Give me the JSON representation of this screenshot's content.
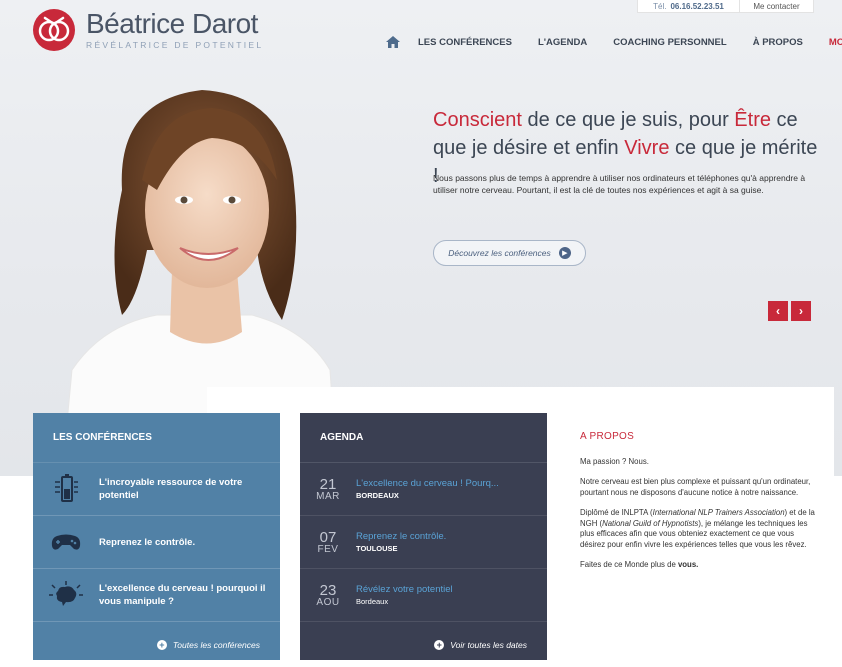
{
  "header": {
    "contact": {
      "tel_label": "Tél.",
      "tel_number": "06.16.52.23.51",
      "contact_label": "Me contacter"
    },
    "brand": {
      "name": "Béatrice Darot",
      "tagline": "RÉVÉLATRICE DE POTENTIEL"
    },
    "nav": {
      "home_icon": "home-icon",
      "items": [
        "LES CONFÉRENCES",
        "L'AGENDA",
        "COACHING PERSONNEL",
        "À PROPOS"
      ],
      "blog": "MON BLOG"
    }
  },
  "hero": {
    "headline": {
      "w1": "Conscient",
      "t1": " de ce que je suis, pour ",
      "w2": "Être",
      "t2": " ce que je désire et enfin ",
      "w3": "Vivre",
      "t3": " ce que je mérite !"
    },
    "lead": "Nous passons plus de temps à apprendre à utiliser nos ordinateurs et téléphones qu'à apprendre à utiliser notre cerveau. Pourtant, il est la clé de toutes nos expériences et agit à sa guise.",
    "cta": "Découvrez les conférences",
    "prev": "‹",
    "next": "›"
  },
  "conferences": {
    "title": "LES CONFÉRENCES",
    "items": [
      {
        "icon": "battery-icon",
        "label": "L'incroyable ressource de votre potentiel"
      },
      {
        "icon": "gamepad-icon",
        "label": "Reprenez le contrôle."
      },
      {
        "icon": "brain-icon",
        "label": "L'excellence du cerveau ! pourquoi il vous manipule ?"
      }
    ],
    "footer": "Toutes les conférences"
  },
  "agenda": {
    "title": "AGENDA",
    "items": [
      {
        "day": "21",
        "month": "MAR",
        "title": "L'excellence du cerveau ! Pourq...",
        "city": "BORDEAUX"
      },
      {
        "day": "07",
        "month": "FEV",
        "title": "Reprenez le contrôle.",
        "city": "TOULOUSE"
      },
      {
        "day": "23",
        "month": "AOU",
        "title": "Révélez votre potentiel",
        "city": "Bordeaux"
      }
    ],
    "footer": "Voir toutes les dates"
  },
  "about": {
    "title": "A PROPOS",
    "p1": "Ma passion ? Nous.",
    "p2": "Notre cerveau est bien plus complexe et puissant qu'un ordinateur, pourtant nous ne disposons d'aucune notice à notre naissance.",
    "p3a": "Diplômé de INLPTA (",
    "p3b": "International NLP Trainers Association",
    "p3c": ") et de la NGH (",
    "p3d": "National Guild of Hypnotists",
    "p3e": "), je mélange les techniques les plus efficaces afin que vous obteniez exactement ce que vous désirez pour enfin vivre les expériences telles que vous les rêvez.",
    "p4a": "Faites de ce Monde plus de ",
    "p4b": "vous."
  },
  "colors": {
    "accent": "#c8293a",
    "conf_bg": "#5181a6",
    "agenda_bg": "#3a3f52",
    "link_blue": "#5aa3d6"
  }
}
